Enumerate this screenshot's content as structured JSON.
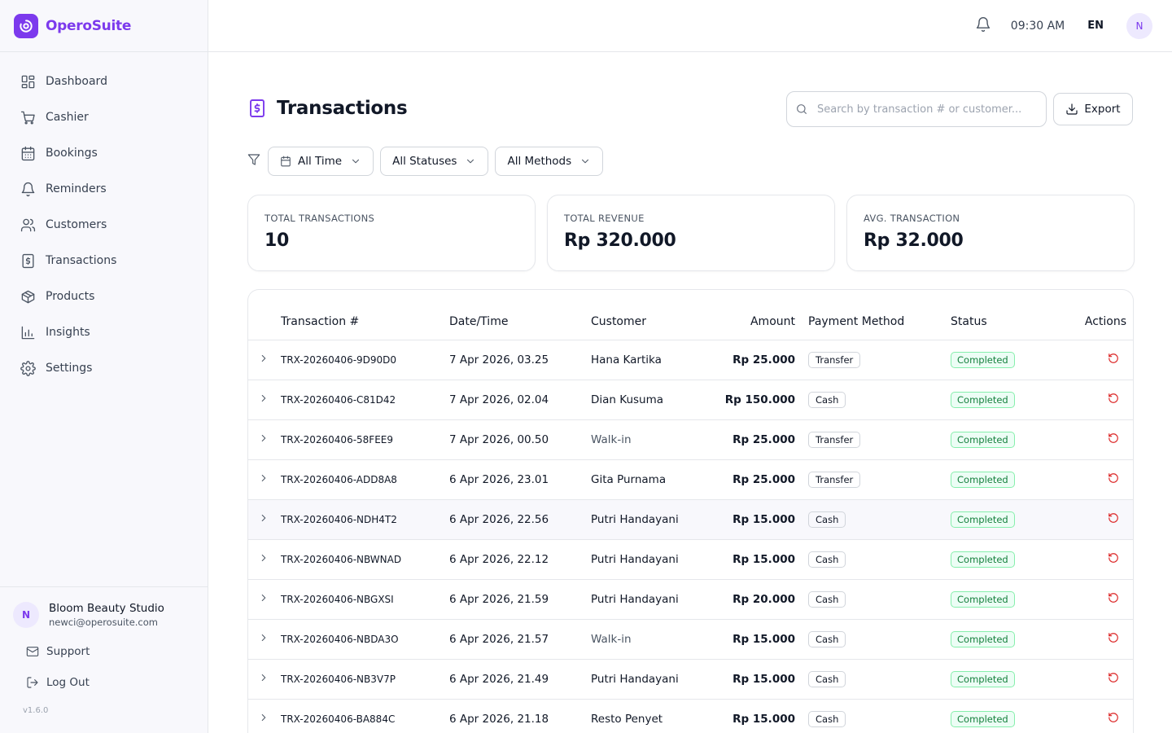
{
  "brand": {
    "name": "OperoSuite",
    "accent": "#7c3aed"
  },
  "sidebar": {
    "items": [
      {
        "label": "Dashboard",
        "icon": "dashboard-icon"
      },
      {
        "label": "Cashier",
        "icon": "cart-icon"
      },
      {
        "label": "Bookings",
        "icon": "calendar-icon"
      },
      {
        "label": "Reminders",
        "icon": "bell-icon"
      },
      {
        "label": "Customers",
        "icon": "users-icon"
      },
      {
        "label": "Transactions",
        "icon": "receipt-icon"
      },
      {
        "label": "Products",
        "icon": "box-icon"
      },
      {
        "label": "Insights",
        "icon": "chart-icon"
      },
      {
        "label": "Settings",
        "icon": "gear-icon"
      }
    ],
    "user": {
      "initial": "N",
      "name": "Bloom Beauty Studio",
      "email": "newci@operosuite.com"
    },
    "support_label": "Support",
    "logout_label": "Log Out",
    "version": "v1.6.0"
  },
  "topbar": {
    "time": "09:30 AM",
    "lang": "EN",
    "avatar_initial": "N"
  },
  "page": {
    "title": "Transactions",
    "search_placeholder": "Search by transaction # or customer...",
    "export_label": "Export"
  },
  "filters": {
    "time": "All Time",
    "status": "All Statuses",
    "method": "All Methods"
  },
  "stats": [
    {
      "label": "TOTAL TRANSACTIONS",
      "value": "10"
    },
    {
      "label": "TOTAL REVENUE",
      "value": "Rp 320.000"
    },
    {
      "label": "AVG. TRANSACTION",
      "value": "Rp 32.000"
    }
  ],
  "table": {
    "columns": {
      "id": "Transaction #",
      "date": "Date/Time",
      "customer": "Customer",
      "amount": "Amount",
      "method": "Payment Method",
      "status": "Status",
      "actions": "Actions"
    },
    "rows": [
      {
        "id": "TRX-20260406-9D90D0",
        "date": "7 Apr 2026, 03.25",
        "customer": "Hana Kartika",
        "amount": "Rp 25.000",
        "method": "Transfer",
        "status": "Completed"
      },
      {
        "id": "TRX-20260406-C81D42",
        "date": "7 Apr 2026, 02.04",
        "customer": "Dian Kusuma",
        "amount": "Rp 150.000",
        "method": "Cash",
        "status": "Completed"
      },
      {
        "id": "TRX-20260406-58FEE9",
        "date": "7 Apr 2026, 00.50",
        "customer": "Walk-in",
        "amount": "Rp 25.000",
        "method": "Transfer",
        "status": "Completed"
      },
      {
        "id": "TRX-20260406-ADD8A8",
        "date": "6 Apr 2026, 23.01",
        "customer": "Gita Purnama",
        "amount": "Rp 25.000",
        "method": "Transfer",
        "status": "Completed"
      },
      {
        "id": "TRX-20260406-NDH4T2",
        "date": "6 Apr 2026, 22.56",
        "customer": "Putri Handayani",
        "amount": "Rp 15.000",
        "method": "Cash",
        "status": "Completed"
      },
      {
        "id": "TRX-20260406-NBWNAD",
        "date": "6 Apr 2026, 22.12",
        "customer": "Putri Handayani",
        "amount": "Rp 15.000",
        "method": "Cash",
        "status": "Completed"
      },
      {
        "id": "TRX-20260406-NBGXSI",
        "date": "6 Apr 2026, 21.59",
        "customer": "Putri Handayani",
        "amount": "Rp 20.000",
        "method": "Cash",
        "status": "Completed"
      },
      {
        "id": "TRX-20260406-NBDA3O",
        "date": "6 Apr 2026, 21.57",
        "customer": "Walk-in",
        "amount": "Rp 15.000",
        "method": "Cash",
        "status": "Completed"
      },
      {
        "id": "TRX-20260406-NB3V7P",
        "date": "6 Apr 2026, 21.49",
        "customer": "Putri Handayani",
        "amount": "Rp 15.000",
        "method": "Cash",
        "status": "Completed"
      },
      {
        "id": "TRX-20260406-BA884C",
        "date": "6 Apr 2026, 21.18",
        "customer": "Resto Penyet",
        "amount": "Rp 15.000",
        "method": "Cash",
        "status": "Completed"
      }
    ]
  }
}
